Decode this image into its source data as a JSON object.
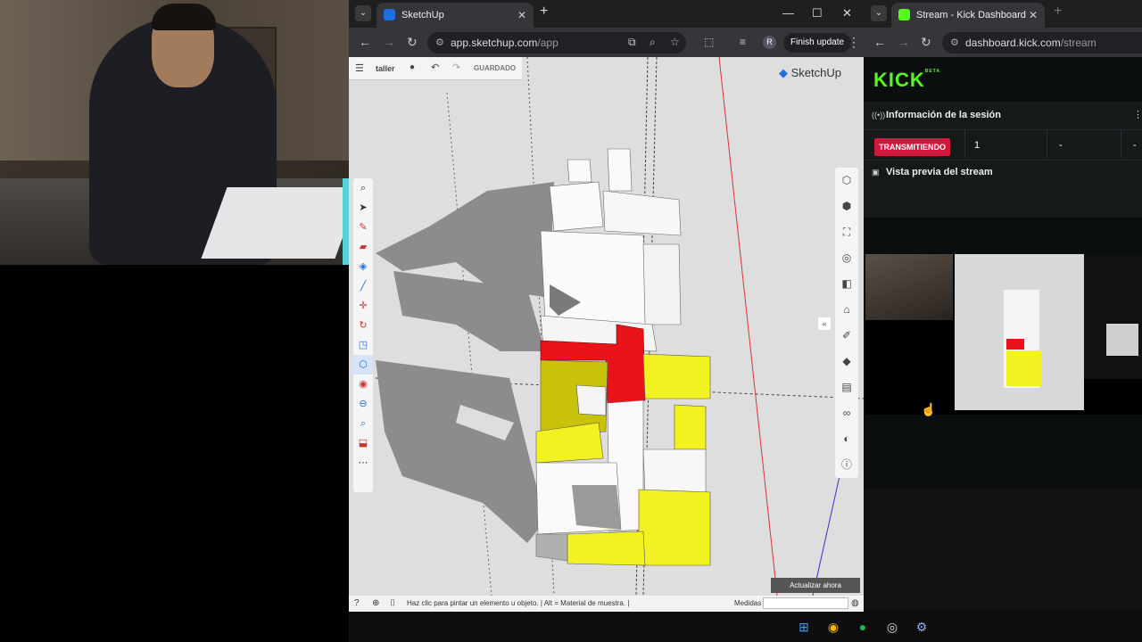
{
  "browser_left": {
    "tab_title": "SketchUp",
    "url_prefix": "app.sketchup.com",
    "url_path": "/app",
    "finish_update": "Finish update",
    "profile_letter": "R"
  },
  "sketchup": {
    "project_name": "taller",
    "saved_status": "GUARDADO",
    "brand": "SketchUp",
    "status_hint": "Haz clic para pintar un elemento u objeto. | Alt = Material de muestra. |",
    "measurements_label": "Medidas",
    "update_now": "Actualizar ahora",
    "left_tools": [
      "search-icon",
      "select-icon",
      "pencil-icon",
      "eraser-icon",
      "paint-bucket-icon",
      "line-icon",
      "move-icon",
      "rotate-icon",
      "scale-icon",
      "push-pull-icon",
      "tape-measure-icon",
      "orbit-icon",
      "zoom-icon",
      "section-icon",
      "more-icon"
    ],
    "right_panels": [
      "entity-info-icon",
      "components-icon",
      "materials-icon",
      "styles-icon",
      "layers-icon",
      "scenes-icon",
      "outliner-icon",
      "display-icon",
      "instructor-icon",
      "glasses-icon",
      "shadows-icon",
      "info-icon"
    ]
  },
  "browser_right": {
    "tab_title": "Stream - Kick Dashboard",
    "url_prefix": "dashboard.kick.com",
    "url_path": "/stream"
  },
  "kick": {
    "logo": "KICK",
    "logo_beta": "BETA",
    "session_info": "Información de la sesión",
    "live_badge": "TRANSMITIENDO",
    "viewers": "1",
    "stat2": "-",
    "stat3": "-",
    "stream_preview": "Vista previa del stream"
  },
  "taskbar": {
    "icons": [
      "windows-start-icon",
      "chrome-icon",
      "spotify-icon",
      "obs-icon",
      "settings-icon"
    ]
  },
  "colors": {
    "kick_green": "#53fc18",
    "live_red": "#d2173c",
    "model_red": "#e8141a",
    "model_yellow": "#f2f221"
  }
}
